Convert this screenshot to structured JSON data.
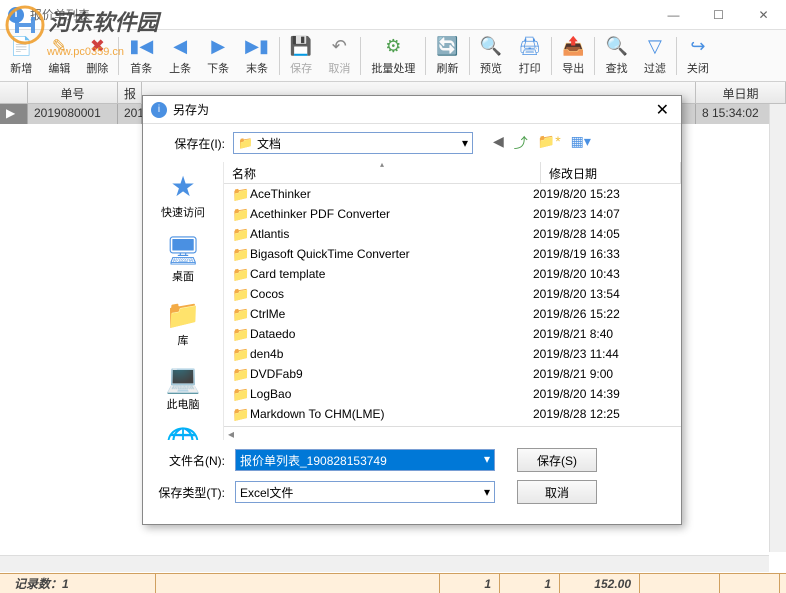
{
  "window": {
    "title": "报价单列表"
  },
  "watermark": {
    "site_name": "河东软件园",
    "url": "www.pc0359.cn"
  },
  "toolbar": [
    {
      "label": "新增",
      "icon": "📄",
      "color": "#4a90e2"
    },
    {
      "label": "编辑",
      "icon": "✎",
      "color": "#e8a030"
    },
    {
      "label": "删除",
      "icon": "✖",
      "color": "#d04040"
    },
    {
      "label": "首条",
      "icon": "▮◀",
      "color": "#4a90e2",
      "sep_before": true
    },
    {
      "label": "上条",
      "icon": "◀",
      "color": "#4a90e2"
    },
    {
      "label": "下条",
      "icon": "▶",
      "color": "#4a90e2"
    },
    {
      "label": "末条",
      "icon": "▶▮",
      "color": "#4a90e2"
    },
    {
      "label": "保存",
      "icon": "💾",
      "disabled": true,
      "sep_before": true
    },
    {
      "label": "取消",
      "icon": "↶",
      "disabled": true
    },
    {
      "label": "批量处理",
      "icon": "⚙",
      "color": "#50a050",
      "sep_before": true
    },
    {
      "label": "刷新",
      "icon": "🔄",
      "color": "#50a050",
      "sep_before": true
    },
    {
      "label": "预览",
      "icon": "🔍",
      "color": "#4a90e2",
      "sep_before": true
    },
    {
      "label": "打印",
      "icon": "🖨",
      "color": "#4a90e2"
    },
    {
      "label": "导出",
      "icon": "📤",
      "color": "#50a050",
      "sep_before": true
    },
    {
      "label": "查找",
      "icon": "🔍",
      "color": "#4a90e2",
      "sep_before": true
    },
    {
      "label": "过滤",
      "icon": "▽",
      "color": "#4a90e2"
    },
    {
      "label": "关闭",
      "icon": "↪",
      "color": "#4a90e2",
      "sep_before": true
    }
  ],
  "grid": {
    "columns": [
      "",
      "单号",
      "报",
      "单日期"
    ],
    "row": {
      "id": "2019080001",
      "col2": "201",
      "date": "8 15:34:02"
    }
  },
  "dialog": {
    "title": "另存为",
    "location_label": "保存在(I):",
    "location_value": "文档",
    "sidebar": [
      {
        "label": "快速访问",
        "icon": "★",
        "color": "#4a90e2"
      },
      {
        "label": "桌面",
        "icon": "🖥",
        "color": "#4a90e2"
      },
      {
        "label": "库",
        "icon": "📁",
        "color": "#f0c040"
      },
      {
        "label": "此电脑",
        "icon": "💻",
        "color": "#888"
      },
      {
        "label": "网络",
        "icon": "🌐",
        "color": "#4a90e2"
      }
    ],
    "file_columns": {
      "name": "名称",
      "date": "修改日期"
    },
    "files": [
      {
        "name": "AceThinker",
        "date": "2019/8/20 15:23"
      },
      {
        "name": "Acethinker PDF Converter",
        "date": "2019/8/23 14:07"
      },
      {
        "name": "Atlantis",
        "date": "2019/8/28 14:05"
      },
      {
        "name": "Bigasoft QuickTime Converter",
        "date": "2019/8/19 16:33"
      },
      {
        "name": "Card template",
        "date": "2019/8/20 10:43"
      },
      {
        "name": "Cocos",
        "date": "2019/8/20 13:54"
      },
      {
        "name": "CtrlMe",
        "date": "2019/8/26 15:22"
      },
      {
        "name": "Dataedo",
        "date": "2019/8/21 8:40"
      },
      {
        "name": "den4b",
        "date": "2019/8/23 11:44"
      },
      {
        "name": "DVDFab9",
        "date": "2019/8/21 9:00"
      },
      {
        "name": "LogBao",
        "date": "2019/8/20 14:39"
      },
      {
        "name": "Markdown To CHM(LME)",
        "date": "2019/8/28 12:25"
      }
    ],
    "filename_label": "文件名(N):",
    "filename_value": "报价单列表_190828153749",
    "filetype_label": "保存类型(T):",
    "filetype_value": "Excel文件",
    "save_btn": "保存(S)",
    "cancel_btn": "取消"
  },
  "status": {
    "record_label": "记录数：",
    "record_count": "1",
    "val1": "1",
    "val2": "1",
    "val3": "152.00"
  }
}
